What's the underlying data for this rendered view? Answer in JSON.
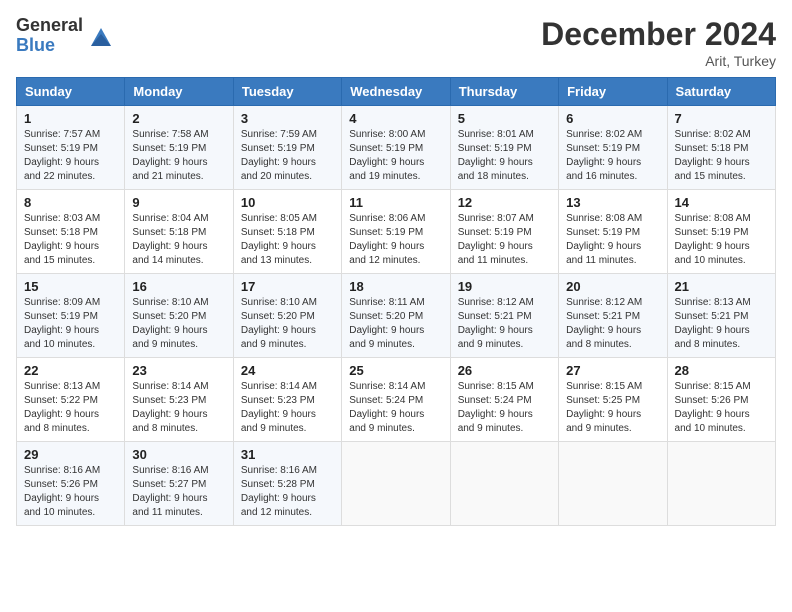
{
  "header": {
    "logo_general": "General",
    "logo_blue": "Blue",
    "month_title": "December 2024",
    "location": "Arit, Turkey"
  },
  "days_of_week": [
    "Sunday",
    "Monday",
    "Tuesday",
    "Wednesday",
    "Thursday",
    "Friday",
    "Saturday"
  ],
  "weeks": [
    [
      {
        "day": "1",
        "sunrise": "Sunrise: 7:57 AM",
        "sunset": "Sunset: 5:19 PM",
        "daylight": "Daylight: 9 hours and 22 minutes."
      },
      {
        "day": "2",
        "sunrise": "Sunrise: 7:58 AM",
        "sunset": "Sunset: 5:19 PM",
        "daylight": "Daylight: 9 hours and 21 minutes."
      },
      {
        "day": "3",
        "sunrise": "Sunrise: 7:59 AM",
        "sunset": "Sunset: 5:19 PM",
        "daylight": "Daylight: 9 hours and 20 minutes."
      },
      {
        "day": "4",
        "sunrise": "Sunrise: 8:00 AM",
        "sunset": "Sunset: 5:19 PM",
        "daylight": "Daylight: 9 hours and 19 minutes."
      },
      {
        "day": "5",
        "sunrise": "Sunrise: 8:01 AM",
        "sunset": "Sunset: 5:19 PM",
        "daylight": "Daylight: 9 hours and 18 minutes."
      },
      {
        "day": "6",
        "sunrise": "Sunrise: 8:02 AM",
        "sunset": "Sunset: 5:19 PM",
        "daylight": "Daylight: 9 hours and 16 minutes."
      },
      {
        "day": "7",
        "sunrise": "Sunrise: 8:02 AM",
        "sunset": "Sunset: 5:18 PM",
        "daylight": "Daylight: 9 hours and 15 minutes."
      }
    ],
    [
      {
        "day": "8",
        "sunrise": "Sunrise: 8:03 AM",
        "sunset": "Sunset: 5:18 PM",
        "daylight": "Daylight: 9 hours and 15 minutes."
      },
      {
        "day": "9",
        "sunrise": "Sunrise: 8:04 AM",
        "sunset": "Sunset: 5:18 PM",
        "daylight": "Daylight: 9 hours and 14 minutes."
      },
      {
        "day": "10",
        "sunrise": "Sunrise: 8:05 AM",
        "sunset": "Sunset: 5:18 PM",
        "daylight": "Daylight: 9 hours and 13 minutes."
      },
      {
        "day": "11",
        "sunrise": "Sunrise: 8:06 AM",
        "sunset": "Sunset: 5:19 PM",
        "daylight": "Daylight: 9 hours and 12 minutes."
      },
      {
        "day": "12",
        "sunrise": "Sunrise: 8:07 AM",
        "sunset": "Sunset: 5:19 PM",
        "daylight": "Daylight: 9 hours and 11 minutes."
      },
      {
        "day": "13",
        "sunrise": "Sunrise: 8:08 AM",
        "sunset": "Sunset: 5:19 PM",
        "daylight": "Daylight: 9 hours and 11 minutes."
      },
      {
        "day": "14",
        "sunrise": "Sunrise: 8:08 AM",
        "sunset": "Sunset: 5:19 PM",
        "daylight": "Daylight: 9 hours and 10 minutes."
      }
    ],
    [
      {
        "day": "15",
        "sunrise": "Sunrise: 8:09 AM",
        "sunset": "Sunset: 5:19 PM",
        "daylight": "Daylight: 9 hours and 10 minutes."
      },
      {
        "day": "16",
        "sunrise": "Sunrise: 8:10 AM",
        "sunset": "Sunset: 5:20 PM",
        "daylight": "Daylight: 9 hours and 9 minutes."
      },
      {
        "day": "17",
        "sunrise": "Sunrise: 8:10 AM",
        "sunset": "Sunset: 5:20 PM",
        "daylight": "Daylight: 9 hours and 9 minutes."
      },
      {
        "day": "18",
        "sunrise": "Sunrise: 8:11 AM",
        "sunset": "Sunset: 5:20 PM",
        "daylight": "Daylight: 9 hours and 9 minutes."
      },
      {
        "day": "19",
        "sunrise": "Sunrise: 8:12 AM",
        "sunset": "Sunset: 5:21 PM",
        "daylight": "Daylight: 9 hours and 9 minutes."
      },
      {
        "day": "20",
        "sunrise": "Sunrise: 8:12 AM",
        "sunset": "Sunset: 5:21 PM",
        "daylight": "Daylight: 9 hours and 8 minutes."
      },
      {
        "day": "21",
        "sunrise": "Sunrise: 8:13 AM",
        "sunset": "Sunset: 5:21 PM",
        "daylight": "Daylight: 9 hours and 8 minutes."
      }
    ],
    [
      {
        "day": "22",
        "sunrise": "Sunrise: 8:13 AM",
        "sunset": "Sunset: 5:22 PM",
        "daylight": "Daylight: 9 hours and 8 minutes."
      },
      {
        "day": "23",
        "sunrise": "Sunrise: 8:14 AM",
        "sunset": "Sunset: 5:23 PM",
        "daylight": "Daylight: 9 hours and 8 minutes."
      },
      {
        "day": "24",
        "sunrise": "Sunrise: 8:14 AM",
        "sunset": "Sunset: 5:23 PM",
        "daylight": "Daylight: 9 hours and 9 minutes."
      },
      {
        "day": "25",
        "sunrise": "Sunrise: 8:14 AM",
        "sunset": "Sunset: 5:24 PM",
        "daylight": "Daylight: 9 hours and 9 minutes."
      },
      {
        "day": "26",
        "sunrise": "Sunrise: 8:15 AM",
        "sunset": "Sunset: 5:24 PM",
        "daylight": "Daylight: 9 hours and 9 minutes."
      },
      {
        "day": "27",
        "sunrise": "Sunrise: 8:15 AM",
        "sunset": "Sunset: 5:25 PM",
        "daylight": "Daylight: 9 hours and 9 minutes."
      },
      {
        "day": "28",
        "sunrise": "Sunrise: 8:15 AM",
        "sunset": "Sunset: 5:26 PM",
        "daylight": "Daylight: 9 hours and 10 minutes."
      }
    ],
    [
      {
        "day": "29",
        "sunrise": "Sunrise: 8:16 AM",
        "sunset": "Sunset: 5:26 PM",
        "daylight": "Daylight: 9 hours and 10 minutes."
      },
      {
        "day": "30",
        "sunrise": "Sunrise: 8:16 AM",
        "sunset": "Sunset: 5:27 PM",
        "daylight": "Daylight: 9 hours and 11 minutes."
      },
      {
        "day": "31",
        "sunrise": "Sunrise: 8:16 AM",
        "sunset": "Sunset: 5:28 PM",
        "daylight": "Daylight: 9 hours and 12 minutes."
      },
      null,
      null,
      null,
      null
    ]
  ]
}
